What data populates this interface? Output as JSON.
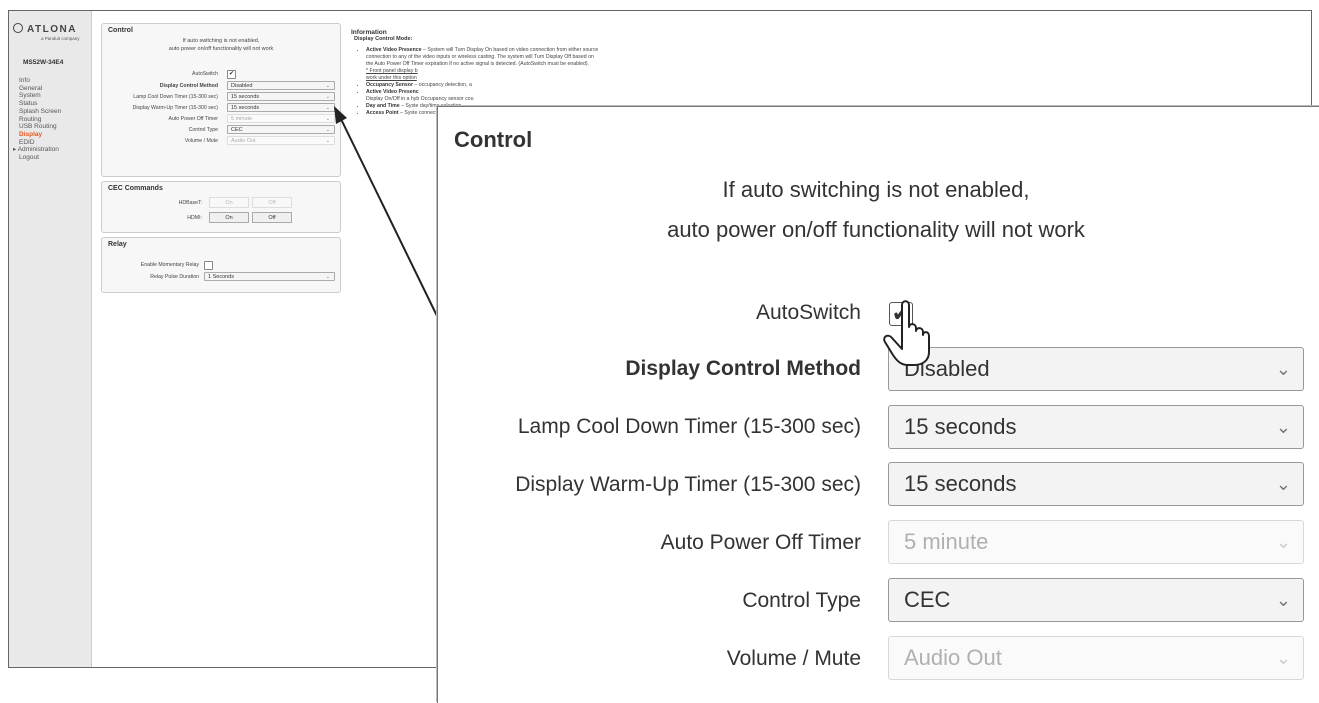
{
  "sidebar": {
    "logo_text": "ATLONA",
    "logo_sub": "a Panduit company",
    "model": "MS52W-34E4",
    "items": [
      {
        "label": "Info"
      },
      {
        "label": "General"
      },
      {
        "label": "System"
      },
      {
        "label": "Status"
      },
      {
        "label": "Splash Screen"
      },
      {
        "label": "Routing"
      },
      {
        "label": "USB Routing"
      },
      {
        "label": "Display",
        "active": true
      },
      {
        "label": "EDID"
      },
      {
        "label": "Administration"
      },
      {
        "label": "Logout"
      }
    ],
    "expand_arrow": "▸"
  },
  "control": {
    "title": "Control",
    "note_line1": "If auto switching is not enabled,",
    "note_line2": "auto power on/off functionality will not work",
    "autoswitch_label": "AutoSwitch",
    "autoswitch_checked": true,
    "display_control_method_label": "Display Control Method",
    "display_control_method_value": "Disabled",
    "lamp_label": "Lamp Cool Down Timer (15-300 sec)",
    "lamp_value": "15 seconds",
    "warmup_label": "Display Warm-Up Timer (15-300 sec)",
    "warmup_value": "15 seconds",
    "auto_power_label": "Auto Power Off Timer",
    "auto_power_value": "5 minute",
    "control_type_label": "Control Type",
    "control_type_value": "CEC",
    "volume_label": "Volume / Mute",
    "volume_value": "Audio Out",
    "chevron": "⌄",
    "check": "✔"
  },
  "cec": {
    "title": "CEC Commands",
    "hdbaset_label": "HDBaseT:",
    "hdmi_label": "HDMI:",
    "on": "On",
    "off": "Off"
  },
  "relay": {
    "title": "Relay",
    "momentary_label": "Enable Momentary Relay",
    "momentary_checked": false,
    "duration_label": "Relay Pulse Duration",
    "duration_value": "1 Seconds"
  },
  "information": {
    "title": "Information",
    "subtitle": "Display Control Mode:",
    "b1_title": "Active Video Presence",
    "b1_text": " – System will Turn Display On based on video connection from either source connection to any of the video inputs or wireless casting. The system will Turn Display Off based on the Auto Power Off Timer expiration if no active signal is detected. (AutoSwitch must be enabled).",
    "b1_note": "* Front panel display b",
    "b1_note2": "work under this option",
    "b2_title": "Occupancy Sensor",
    "b2_text": " – occupancy detection, a",
    "b3_title": "Active Video Presenc",
    "b3_text": "Display On/Off in a hyb Occupancy sensor cou",
    "b4_title": "Day and Time",
    "b4_text": " – Syste day/time selection.",
    "b5_title": "Access Point",
    "b5_text": " – Syste connect/disconnect fro"
  },
  "colors": {
    "accent": "#e8551c",
    "sidebar_bg": "#e9e9e9",
    "panel_bg": "#f7f7f7"
  }
}
